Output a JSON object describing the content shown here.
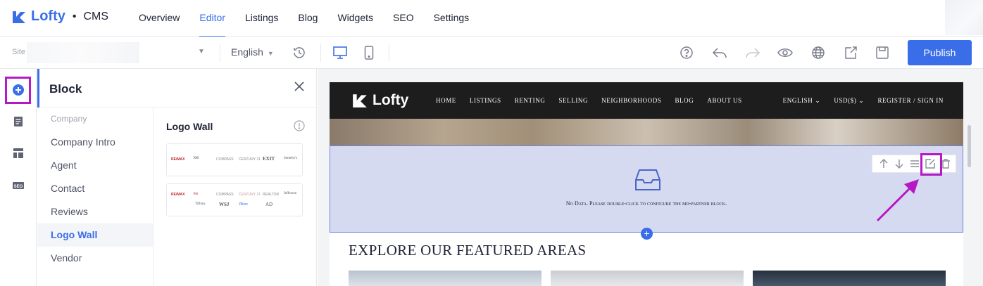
{
  "app": {
    "brand": "Lofty",
    "separator": "•",
    "product": "CMS"
  },
  "nav": {
    "items": [
      "Overview",
      "Editor",
      "Listings",
      "Blog",
      "Widgets",
      "SEO",
      "Settings"
    ],
    "active": "Editor"
  },
  "toolbar": {
    "site_label": "Site",
    "language": "English",
    "publish_label": "Publish",
    "icons": [
      "history-icon",
      "desktop-icon",
      "mobile-icon",
      "help-icon",
      "undo-icon",
      "redo-icon",
      "preview-icon",
      "globe-icon",
      "export-icon",
      "save-icon"
    ]
  },
  "rail": {
    "icons": [
      "add-block-icon",
      "pages-icon",
      "layout-icon",
      "seo-icon"
    ],
    "seo_text": "SEO"
  },
  "panel": {
    "title": "Block",
    "categories": [
      "Company",
      "Company Intro",
      "Agent",
      "Contact",
      "Reviews",
      "Logo Wall",
      "Vendor"
    ],
    "active_category": "Logo Wall",
    "blocks_title": "Logo Wall",
    "card1_logos": [
      "RE/MAX",
      "kw",
      "COMPASS",
      "CENTURY 21",
      "EXIT",
      "Sotheby's"
    ],
    "card2_logos_top": [
      "RE/MAX",
      "kw",
      "COMPASS",
      "CENTURY 21",
      "REALTOR",
      "Jefferson"
    ],
    "card2_logos_bottom": [
      "Tiffany",
      "WSJ",
      "Zillow",
      "AD"
    ]
  },
  "preview": {
    "site_logo": "Lofty",
    "menu": [
      "HOME",
      "LISTINGS",
      "RENTING",
      "SELLING",
      "NEIGHBORHOODS",
      "BLOG",
      "ABOUT US"
    ],
    "right_menu": [
      "ENGLISH ⌄",
      "USD($) ⌄",
      "REGISTER / SIGN IN"
    ],
    "empty_message": "No Data. Please double-click to configure the md-partner block.",
    "section_title": "EXPLORE OUR FEATURED AREAS",
    "add_symbol": "+"
  },
  "colors": {
    "accent": "#3a6ee8",
    "highlight": "#b519c6",
    "block_bg": "#d6daf1"
  }
}
